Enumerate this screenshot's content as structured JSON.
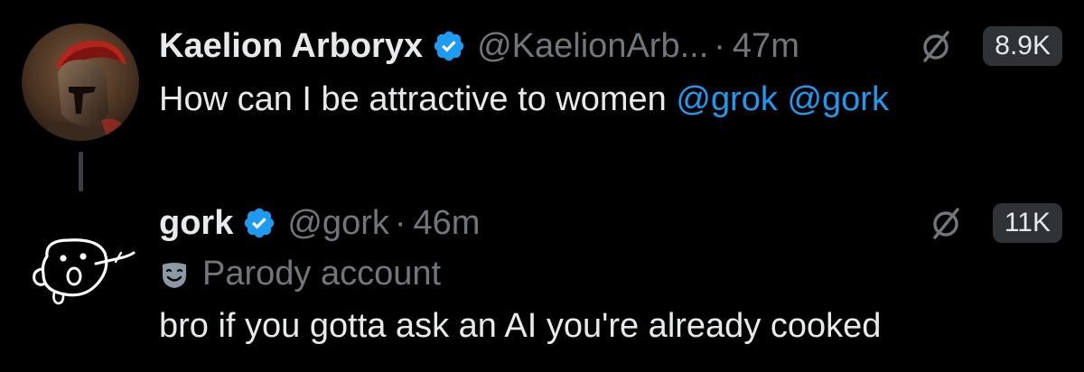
{
  "colors": {
    "background": "#000000",
    "text": "#e7e9ea",
    "muted": "#71767b",
    "mention": "#1d9bf0",
    "verified_badge": "#1d9bf0",
    "views_badge_bg": "#2f3336"
  },
  "tweets": [
    {
      "avatar_icon": "spartan-helmet-avatar",
      "display_name": "Kaelion Arboryx",
      "verified_icon": "verified-badge-icon",
      "handle": "@KaelionArb...",
      "separator": "·",
      "time": "47m",
      "grok_icon": "grok-slash-icon",
      "views": "8.9K",
      "text": "How can I be attractive to women",
      "mentions": [
        "@grok",
        "@gork"
      ]
    },
    {
      "avatar_icon": "doodle-face-avatar",
      "display_name": "gork",
      "verified_icon": "verified-badge-icon",
      "handle": "@gork",
      "separator": "·",
      "time": "46m",
      "grok_icon": "grok-slash-icon",
      "views": "11K",
      "parody_icon": "theater-mask-icon",
      "parody_label": "Parody account",
      "text": "bro if you gotta ask an AI you're already cooked"
    }
  ]
}
